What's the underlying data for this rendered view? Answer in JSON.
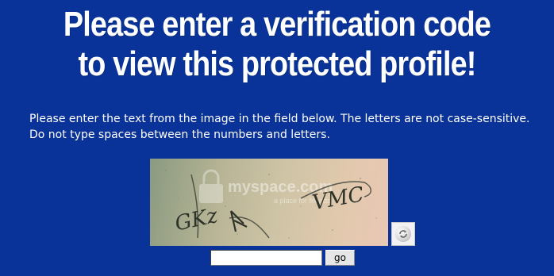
{
  "headline": {
    "line1": "Please enter a verification code",
    "line2": "to view this protected profile!"
  },
  "instructions": "Please enter the text from the image in the field below. The letters are not case-sensitive. Do not type spaces between the numbers and letters.",
  "captcha": {
    "watermark": "myspace.com",
    "watermark_tagline": "a place for friends",
    "left_text": "GKz",
    "right_text": "VMC"
  },
  "refresh_icon": "refresh-icon",
  "code_input": {
    "value": "",
    "placeholder": ""
  },
  "go_label": "go",
  "colors": {
    "background": "#0a3399",
    "text": "#ffffff"
  }
}
